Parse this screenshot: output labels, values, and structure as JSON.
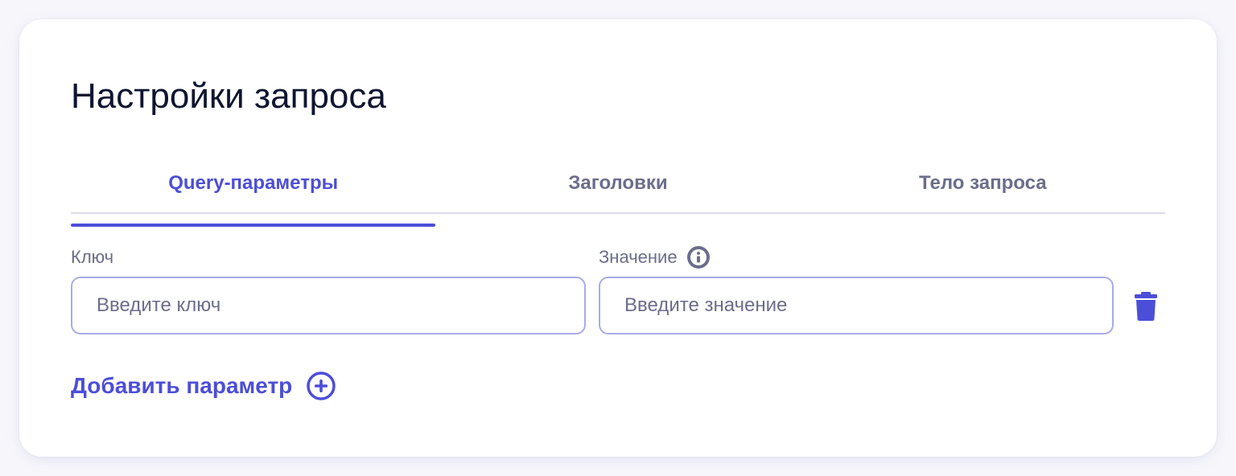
{
  "card": {
    "title": "Настройки запроса"
  },
  "tabs": [
    {
      "label": "Query-параметры",
      "active": true
    },
    {
      "label": "Заголовки",
      "active": false
    },
    {
      "label": "Тело запроса",
      "active": false
    }
  ],
  "params": {
    "key_label": "Ключ",
    "value_label": "Значение",
    "key_placeholder": "Введите ключ",
    "value_placeholder": "Введите значение",
    "key_value": "",
    "value_value": ""
  },
  "actions": {
    "add_label": "Добавить параметр"
  },
  "icons": {
    "info": "info-icon",
    "delete": "trash-icon",
    "add": "plus-circle-icon"
  },
  "colors": {
    "accent": "#4c4ed8",
    "text_primary": "#0f1530",
    "text_secondary": "#6b6d8c",
    "field_border": "#a9aae6",
    "divider": "#dcdcea"
  }
}
